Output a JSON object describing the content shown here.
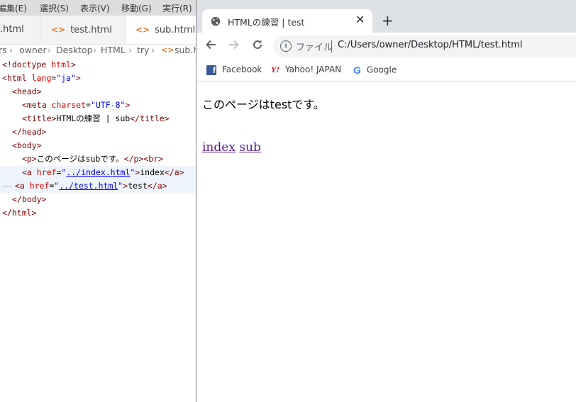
{
  "editor": {
    "menu": [
      "編集(E)",
      "選択(S)",
      "表示(V)",
      "移動(G)",
      "実行(R)"
    ],
    "tabs": [
      ".html",
      "test.html",
      "sub.html"
    ],
    "breadcrumb": [
      "rs",
      "owner",
      "Desktop",
      "HTML",
      "try",
      "sub.h"
    ],
    "code": {
      "l1": [
        "<!doctype ",
        "html",
        ">"
      ],
      "l2": [
        "<html ",
        "lang",
        "=",
        "\"ja\"",
        ">"
      ],
      "l3": [
        "<head>"
      ],
      "l4": [
        "<meta ",
        "charset",
        "=",
        "\"UTF-8\"",
        ">"
      ],
      "l5": [
        "<title>",
        "HTMLの練習 | sub",
        "</title>"
      ],
      "l6": [
        "</head>"
      ],
      "l7": [
        "<body>"
      ],
      "l8": [
        "<p>",
        "このページはsubです。",
        "</p>",
        "<br>"
      ],
      "l9": [
        "<a ",
        "href",
        "=",
        "\"",
        "../index.html",
        "\"",
        ">",
        "index",
        "</a>"
      ],
      "l10": [
        "<a ",
        "href",
        "=",
        "\"",
        "../test.html",
        "\"",
        ">",
        "test",
        "</a>"
      ],
      "l11": [
        "</body>"
      ],
      "l12": [
        "</html>"
      ]
    }
  },
  "browser": {
    "tab_title": "HTMLの練習 | test",
    "new_tab": "+",
    "close": "✕",
    "scheme": "ファイル",
    "url": "C:/Users/owner/Desktop/HTML/test.html",
    "bookmarks": [
      "Facebook",
      "Yahoo! JAPAN",
      "Google"
    ],
    "page": {
      "paragraph": "このページはtestです。",
      "links": [
        "index",
        "sub"
      ]
    }
  },
  "colors": {
    "html_icon": "#e37933",
    "link_visited": "#551a8b",
    "tag": "#800000",
    "attr": "#e50000",
    "value": "#0000ff"
  }
}
